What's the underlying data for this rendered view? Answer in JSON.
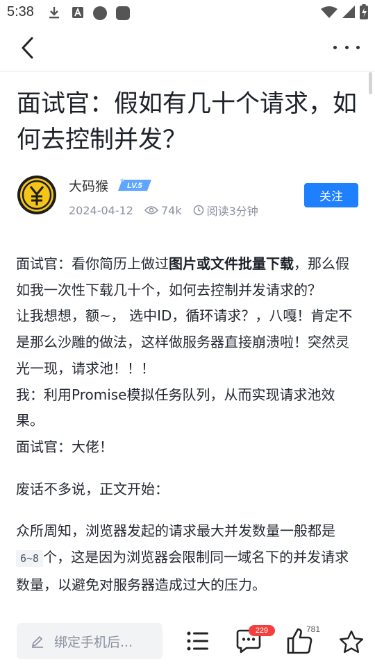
{
  "status_bar": {
    "time": "5:38"
  },
  "article": {
    "title": "面试官：假如有几十个请求，如何去控制并发？",
    "author": {
      "name": "大码猴",
      "level": "LV.5"
    },
    "date": "2024-04-12",
    "views": "74k",
    "read_time": "阅读3分钟",
    "follow_label": "关注"
  },
  "content": {
    "p1_pre": "面试官：看你简历上做过",
    "p1_bold": "图片或文件批量下载",
    "p1_post": "，那么假如我一次性下载几十个，如何去控制并发请求的？",
    "p2": "让我想想，额~， 选中ID，循环请求？，八嘎！肯定不是那么沙雕的做法，这样做服务器直接崩溃啦！突然灵光一现，请求池！！！",
    "p3": "我：利用Promise模拟任务队列，从而实现请求池效果。",
    "p4": "面试官：大佬！",
    "p5": "废话不多说，正文开始：",
    "p6_pre": "众所周知，浏览器发起的请求最大并发数量一般都是",
    "p6_code": "6~8",
    "p6_post": "个，这是因为浏览器会限制同一域名下的并发请求数量，以避免对服务器造成过大的压力。"
  },
  "bottom_bar": {
    "comment_placeholder": "绑定手机后...",
    "comment_count": "229",
    "like_count": "781"
  },
  "colors": {
    "accent": "#1e80ff",
    "badge": "#f53f3f"
  }
}
